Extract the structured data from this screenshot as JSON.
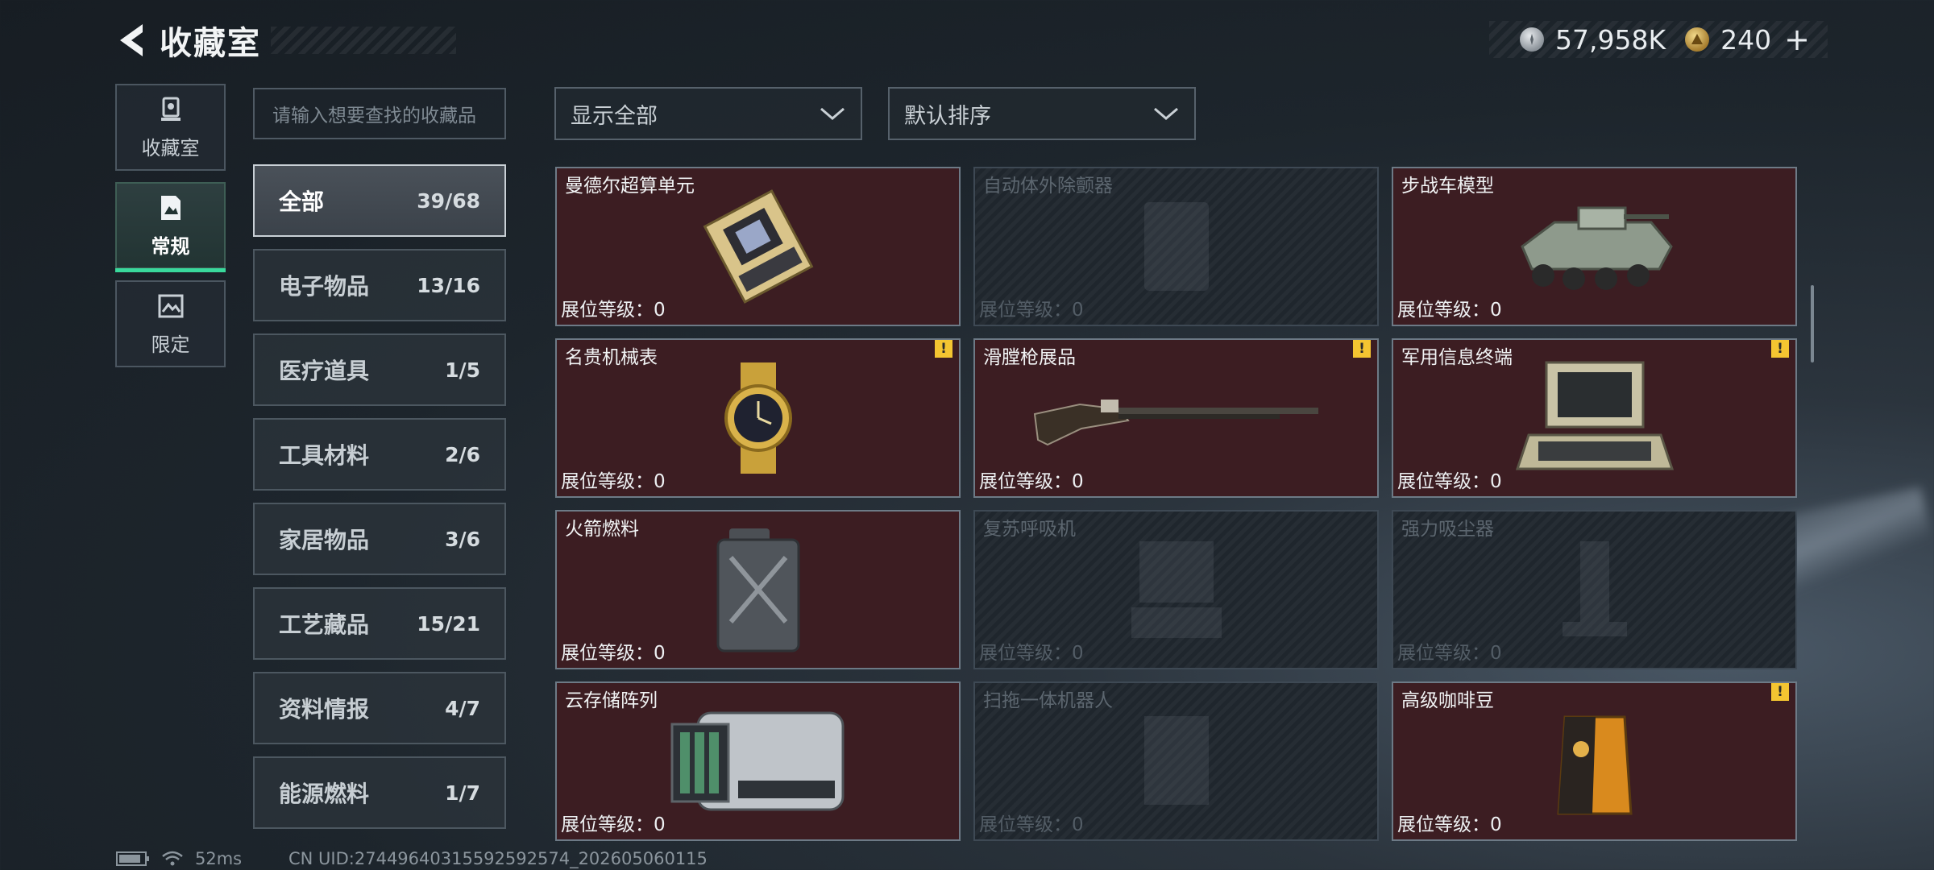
{
  "header": {
    "title": "收藏室"
  },
  "currency": {
    "silver_amount": "57,958K",
    "gold_amount": "240",
    "add_symbol": "+"
  },
  "side_tabs": [
    {
      "label": "收藏室",
      "icon": "trophy-icon"
    },
    {
      "label": "常规",
      "icon": "document-icon",
      "active": true
    },
    {
      "label": "限定",
      "icon": "image-icon"
    }
  ],
  "search": {
    "placeholder": "请输入想要查找的收藏品"
  },
  "categories": [
    {
      "name": "全部",
      "count": "39/68",
      "active": true
    },
    {
      "name": "电子物品",
      "count": "13/16"
    },
    {
      "name": "医疗道具",
      "count": "1/5"
    },
    {
      "name": "工具材料",
      "count": "2/6"
    },
    {
      "name": "家居物品",
      "count": "3/6"
    },
    {
      "name": "工艺藏品",
      "count": "15/21"
    },
    {
      "name": "资料情报",
      "count": "4/7"
    },
    {
      "name": "能源燃料",
      "count": "1/7"
    }
  ],
  "filters": {
    "display": "显示全部",
    "sort": "默认排序"
  },
  "level_label": "展位等级：0",
  "items": [
    {
      "name": "曼德尔超算单元",
      "unlocked": true,
      "warning": false,
      "art": "supercomputer-unit"
    },
    {
      "name": "自动体外除颤器",
      "unlocked": false,
      "warning": false,
      "art": "defibrillator"
    },
    {
      "name": "步战车模型",
      "unlocked": true,
      "warning": false,
      "art": "ifv-model"
    },
    {
      "name": "名贵机械表",
      "unlocked": true,
      "warning": true,
      "art": "watch"
    },
    {
      "name": "滑膛枪展品",
      "unlocked": true,
      "warning": true,
      "art": "musket"
    },
    {
      "name": "军用信息终端",
      "unlocked": true,
      "warning": true,
      "art": "terminal"
    },
    {
      "name": "火箭燃料",
      "unlocked": true,
      "warning": false,
      "art": "jerrycan"
    },
    {
      "name": "复苏呼吸机",
      "unlocked": false,
      "warning": false,
      "art": "ventilator"
    },
    {
      "name": "强力吸尘器",
      "unlocked": false,
      "warning": false,
      "art": "vacuum"
    },
    {
      "name": "云存储阵列",
      "unlocked": true,
      "warning": false,
      "art": "storage-array"
    },
    {
      "name": "扫拖一体机器人",
      "unlocked": false,
      "warning": false,
      "art": "robot-vacuum"
    },
    {
      "name": "高级咖啡豆",
      "unlocked": true,
      "warning": true,
      "art": "coffee-bag"
    }
  ],
  "warning_symbol": "!",
  "status": {
    "ping": "52ms",
    "uid": "CN UID:27449640315592592574_202605060115"
  }
}
